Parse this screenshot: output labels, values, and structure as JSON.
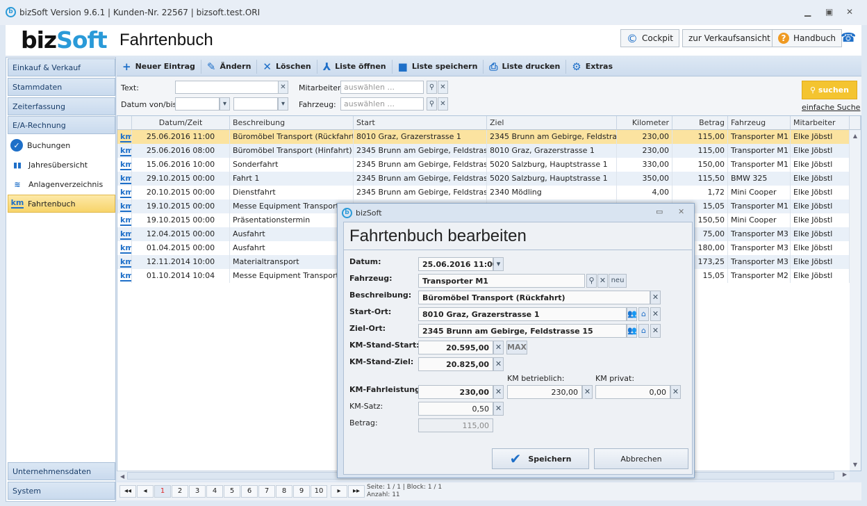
{
  "window": {
    "title": "bizSoft Version 9.6.1 | Kunden-Nr. 22567 | bizsoft.test.ORI",
    "logo": "bizSoft"
  },
  "header": {
    "title": "Fahrtenbuch",
    "cockpit": "Cockpit",
    "verkauf": "zur Verkaufsansicht",
    "handbuch": "Handbuch"
  },
  "sidebar": {
    "sections": [
      "Einkauf & Verkauf",
      "Stammdaten",
      "Zeiterfassung",
      "E/A-Rechnung"
    ],
    "items": [
      "Buchungen",
      "Jahresübersicht",
      "Anlagenverzeichnis",
      "Fahrtenbuch"
    ],
    "bottom": [
      "Unternehmensdaten",
      "System"
    ]
  },
  "toolbar": {
    "new": "Neuer Eintrag",
    "edit": "Ändern",
    "delete": "Löschen",
    "open": "Liste öffnen",
    "save": "Liste speichern",
    "print": "Liste drucken",
    "extras": "Extras"
  },
  "filter": {
    "text_label": "Text:",
    "date_label": "Datum von/bis:",
    "employee_label": "Mitarbeiter:",
    "vehicle_label": "Fahrzeug:",
    "placeholder": "auswählen ...",
    "search": "suchen",
    "simple": "einfache Suche"
  },
  "grid": {
    "columns": [
      "Datum/Zeit",
      "Beschreibung",
      "Start",
      "Ziel",
      "Kilometer",
      "Betrag",
      "Fahrzeug",
      "Mitarbeiter"
    ],
    "rows": [
      [
        "25.06.2016 11:00",
        "Büromöbel Transport (Rückfahrt)",
        "8010 Graz, Grazerstrasse 1",
        "2345 Brunn am Gebirge, Feldstras...",
        "230,00",
        "115,00",
        "Transporter M1",
        "Elke Jöbstl"
      ],
      [
        "25.06.2016 08:00",
        "Büromöbel Transport (Hinfahrt)",
        "2345 Brunn am Gebirge, Feldstrasse...",
        "8010 Graz, Grazerstrasse 1",
        "230,00",
        "115,00",
        "Transporter M1",
        "Elke Jöbstl"
      ],
      [
        "15.06.2016 10:00",
        "Sonderfahrt",
        "2345 Brunn am Gebirge, Feldstrasse...",
        "5020 Salzburg, Hauptstrasse 1",
        "330,00",
        "150,00",
        "Transporter M1",
        "Elke Jöbstl"
      ],
      [
        "29.10.2015 00:00",
        "Fahrt 1",
        "2345 Brunn am Gebirge, Feldstrasse...",
        "5020 Salzburg, Hauptstrasse 1",
        "350,00",
        "115,50",
        "BMW 325",
        "Elke Jöbstl"
      ],
      [
        "20.10.2015 00:00",
        "Dienstfahrt",
        "2345 Brunn am Gebirge, Feldstrasse...",
        "2340 Mödling",
        "4,00",
        "1,72",
        "Mini Cooper",
        "Elke Jöbstl"
      ],
      [
        "19.10.2015 00:00",
        "Messe Equipment Transport",
        "",
        "",
        "",
        "15,05",
        "Transporter M1",
        "Elke Jöbstl"
      ],
      [
        "19.10.2015 00:00",
        "Präsentationstermin",
        "",
        "",
        "",
        "150,50",
        "Mini Cooper",
        "Elke Jöbstl"
      ],
      [
        "12.04.2015 00:00",
        "Ausfahrt",
        "",
        "",
        "",
        "75,00",
        "Transporter M3",
        "Elke Jöbstl"
      ],
      [
        "01.04.2015 00:00",
        "Ausfahrt",
        "",
        "",
        "",
        "180,00",
        "Transporter M3",
        "Elke Jöbstl"
      ],
      [
        "12.11.2014 10:00",
        "Materialtransport",
        "",
        "",
        "",
        "173,25",
        "Transporter M3",
        "Elke Jöbstl"
      ],
      [
        "01.10.2014 10:04",
        "Messe Equipment Transport",
        "",
        "",
        "",
        "15,05",
        "Transporter M2",
        "Elke Jöbstl"
      ]
    ],
    "row_icon": "km"
  },
  "pager": {
    "pages": [
      "1",
      "2",
      "3",
      "4",
      "5",
      "6",
      "7",
      "8",
      "9",
      "10"
    ],
    "info1": "Seite: 1 / 1 | Block: 1 / 1",
    "info2": "Anzahl: 11"
  },
  "dialog": {
    "app": "bizSoft",
    "title": "Fahrtenbuch bearbeiten",
    "datum_label": "Datum:",
    "datum": "25.06.2016 11:00",
    "fahrzeug_label": "Fahrzeug:",
    "fahrzeug": "Transporter M1",
    "neu": "neu",
    "beschreibung_label": "Beschreibung:",
    "beschreibung": "Büromöbel Transport (Rückfahrt)",
    "start_label": "Start-Ort:",
    "start": "8010 Graz, Grazerstrasse 1",
    "ziel_label": "Ziel-Ort:",
    "ziel": "2345 Brunn am Gebirge, Feldstrasse 15",
    "kmstart_label": "KM-Stand-Start:",
    "kmstart": "20.595,00",
    "max": "MAX",
    "kmziel_label": "KM-Stand-Ziel:",
    "kmziel": "20.825,00",
    "betrieb_label": "KM betrieblich:",
    "privat_label": "KM privat:",
    "leistung_label": "KM-Fahrleistung:",
    "leistung": "230,00",
    "betrieb": "230,00",
    "privat": "0,00",
    "satz_label": "KM-Satz:",
    "satz": "0,50",
    "betrag_label": "Betrag:",
    "betrag": "115,00",
    "save": "Speichern",
    "cancel": "Abbrechen"
  }
}
